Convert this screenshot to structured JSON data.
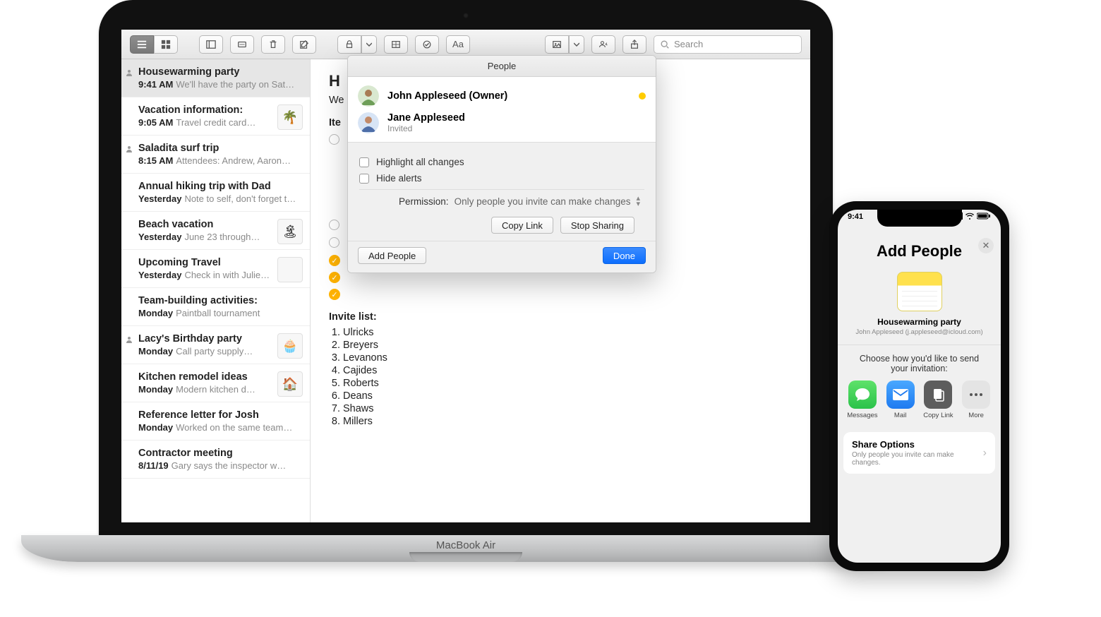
{
  "macbook_label": "MacBook Air",
  "toolbar": {
    "search_placeholder": "Search",
    "font_label": "Aa"
  },
  "sidebar": {
    "items": [
      {
        "shared": true,
        "title": "Housewarming party",
        "time": "9:41 AM",
        "preview": "We'll have the party on Sat…",
        "selected": true
      },
      {
        "shared": false,
        "title": "Vacation information:",
        "time": "9:05 AM",
        "preview": "Travel credit card…",
        "thumb": "🌴"
      },
      {
        "shared": true,
        "title": "Saladita surf trip",
        "time": "8:15 AM",
        "preview": "Attendees: Andrew, Aaron…"
      },
      {
        "shared": false,
        "title": "Annual hiking trip with Dad",
        "time": "Yesterday",
        "preview": "Note to self, don't forget t…"
      },
      {
        "shared": false,
        "title": "Beach vacation",
        "time": "Yesterday",
        "preview": "June 23 through…",
        "thumb": "🏝"
      },
      {
        "shared": false,
        "title": "Upcoming Travel",
        "time": "Yesterday",
        "preview": "Check in with Julie…",
        "thumb": " "
      },
      {
        "shared": false,
        "title": "Team-building activities:",
        "time": "Monday",
        "preview": "Paintball tournament"
      },
      {
        "shared": true,
        "title": "Lacy's Birthday party",
        "time": "Monday",
        "preview": "Call party supply…",
        "thumb": "🧁"
      },
      {
        "shared": false,
        "title": "Kitchen remodel ideas",
        "time": "Monday",
        "preview": "Modern kitchen d…",
        "thumb": "🏠"
      },
      {
        "shared": false,
        "title": "Reference letter for Josh",
        "time": "Monday",
        "preview": "Worked on the same team…"
      },
      {
        "shared": false,
        "title": "Contractor meeting",
        "time": "8/11/19",
        "preview": "Gary says the inspector w…"
      }
    ]
  },
  "editor": {
    "title_partial_1": "H",
    "line1_partial": "We",
    "items_heading_partial": "Ite",
    "invite_heading": "Invite list:",
    "invitees": [
      "Ulricks",
      "Breyers",
      "Levanons",
      "Cajides",
      "Roberts",
      "Deans",
      "Shaws",
      "Millers"
    ]
  },
  "popover": {
    "title": "People",
    "people": [
      {
        "name": "John Appleseed (Owner)",
        "sub": "",
        "dot": true
      },
      {
        "name": "Jane Appleseed",
        "sub": "Invited",
        "dot": false
      }
    ],
    "opt_highlight": "Highlight all changes",
    "opt_hide": "Hide alerts",
    "permission_label": "Permission:",
    "permission_value": "Only people you invite can make changes",
    "btn_copy": "Copy Link",
    "btn_stop": "Stop Sharing",
    "btn_add": "Add People",
    "btn_done": "Done"
  },
  "iphone": {
    "time": "9:41",
    "title": "Add People",
    "file_name": "Housewarming party",
    "file_sub": "John Appleseed (j.appleseed@icloud.com)",
    "choose_text": "Choose how you'd like to send your invitation:",
    "apps": {
      "messages": "Messages",
      "mail": "Mail",
      "copy": "Copy Link",
      "more": "More"
    },
    "share_options_title": "Share Options",
    "share_options_sub": "Only people you invite can make changes."
  }
}
